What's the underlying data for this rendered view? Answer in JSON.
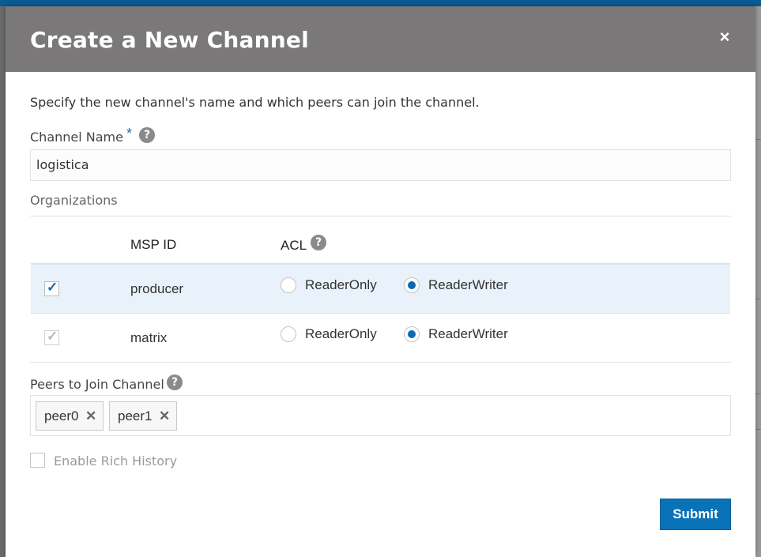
{
  "dialog": {
    "title": "Create a New Channel",
    "close_icon": "×",
    "intro": "Specify the new channel's name and which peers can join the channel."
  },
  "channel_name": {
    "label": "Channel Name",
    "required_mark": "*",
    "help": "?",
    "value": "logistica"
  },
  "organizations": {
    "label": "Organizations",
    "columns": {
      "msp_id": "MSP ID",
      "acl": "ACL",
      "acl_help": "?"
    },
    "rows": [
      {
        "msp_id": "producer",
        "checked": true,
        "selected": true,
        "acl_options": [
          "ReaderOnly",
          "ReaderWriter"
        ],
        "acl_value": "ReaderWriter"
      },
      {
        "msp_id": "matrix",
        "checked": true,
        "disabled": true,
        "acl_options": [
          "ReaderOnly",
          "ReaderWriter"
        ],
        "acl_value": "ReaderWriter"
      }
    ]
  },
  "peers": {
    "label": "Peers to Join Channel",
    "help": "?",
    "chips": [
      {
        "label": "peer0",
        "remove": "✕"
      },
      {
        "label": "peer1",
        "remove": "✕"
      }
    ]
  },
  "rich_history": {
    "label": "Enable Rich History",
    "checked": false
  },
  "actions": {
    "submit": "Submit"
  },
  "colors": {
    "header_bg": "#7a7878",
    "accent": "#0a73b8",
    "selected_row": "#e9f1fa"
  },
  "icons": {
    "help": "question-circle-icon",
    "close": "close-icon",
    "check": "checkmark-icon",
    "chip_remove": "x-icon"
  }
}
